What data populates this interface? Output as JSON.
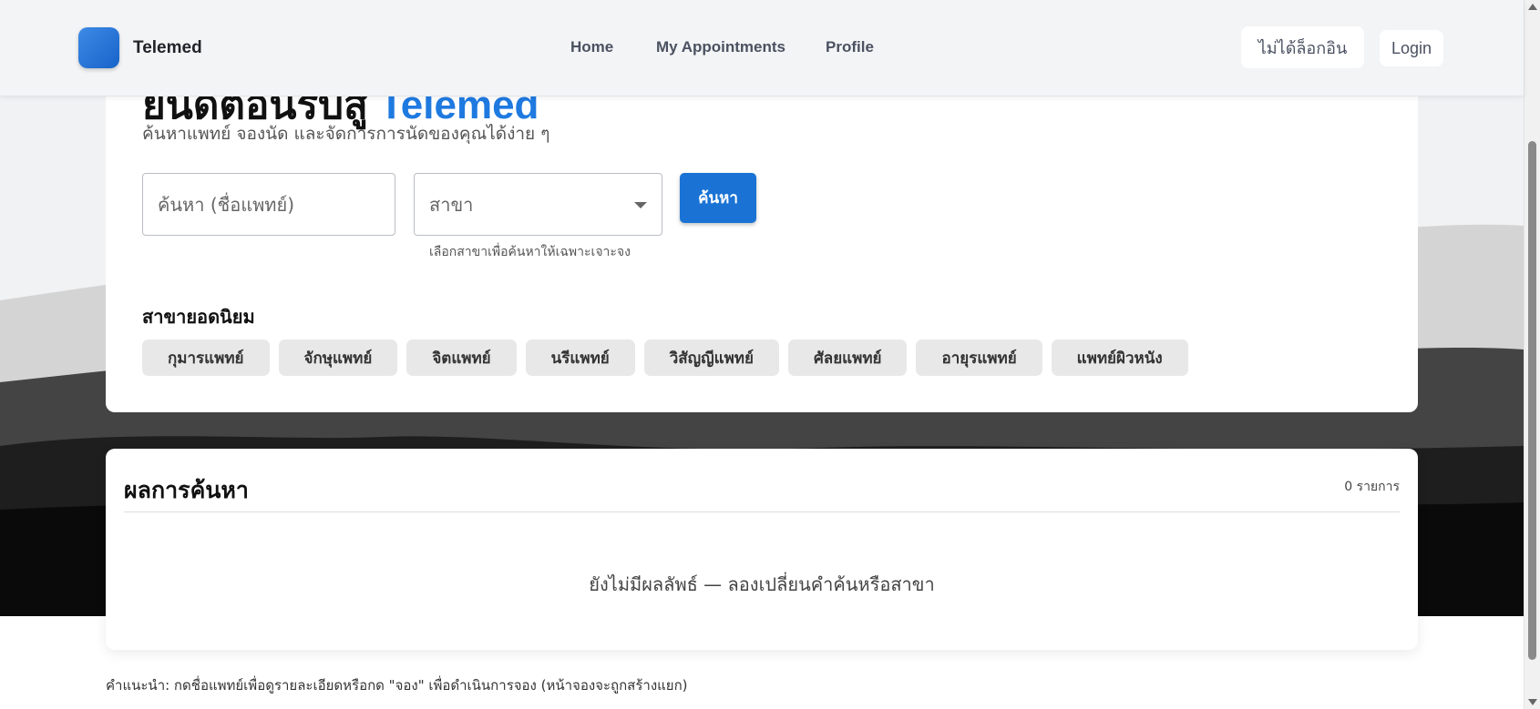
{
  "header": {
    "brand": "Telemed",
    "nav": [
      "Home",
      "My Appointments",
      "Profile"
    ],
    "status_chip": "ไม่ได้ล็อกอิน",
    "login": "Login"
  },
  "search": {
    "headline_prefix": "ยินดีต้อนรับสู่",
    "headline_brand": "Telemed",
    "subtitle": "ค้นหาแพทย์ จองนัด และจัดการการนัดของคุณได้ง่าย ๆ",
    "placeholder": "ค้นหา (ชื่อแพทย์)",
    "branch_select": "สาขา",
    "helper": "เลือกสาขาเพื่อค้นหาให้เฉพาะเจาะจง",
    "button": "ค้นหา"
  },
  "popular": {
    "title": "สาขายอดนิยม",
    "tags": [
      "กุมารแพทย์",
      "จักษุแพทย์",
      "จิตแพทย์",
      "นรีแพทย์",
      "วิสัญญีแพทย์",
      "ศัลยแพทย์",
      "อายุรแพทย์",
      "แพทย์ผิวหนัง"
    ]
  },
  "results": {
    "title": "ผลการค้นหา",
    "count": "0 รายการ",
    "empty": "ยังไม่มีผลลัพธ์ — ลองเปลี่ยนคำค้นหรือสาขา"
  },
  "footer": {
    "hint": "คำแนะนำ: กดชื่อแพทย์เพื่อดูรายละเอียดหรือกด \"จอง\" เพื่อดำเนินการจอง (หน้าจองจะถูกสร้างแยก)"
  },
  "colors": {
    "accent": "#1a73d4",
    "brand_text": "#1f7ae0",
    "header_bg": "#f3f4f6"
  }
}
